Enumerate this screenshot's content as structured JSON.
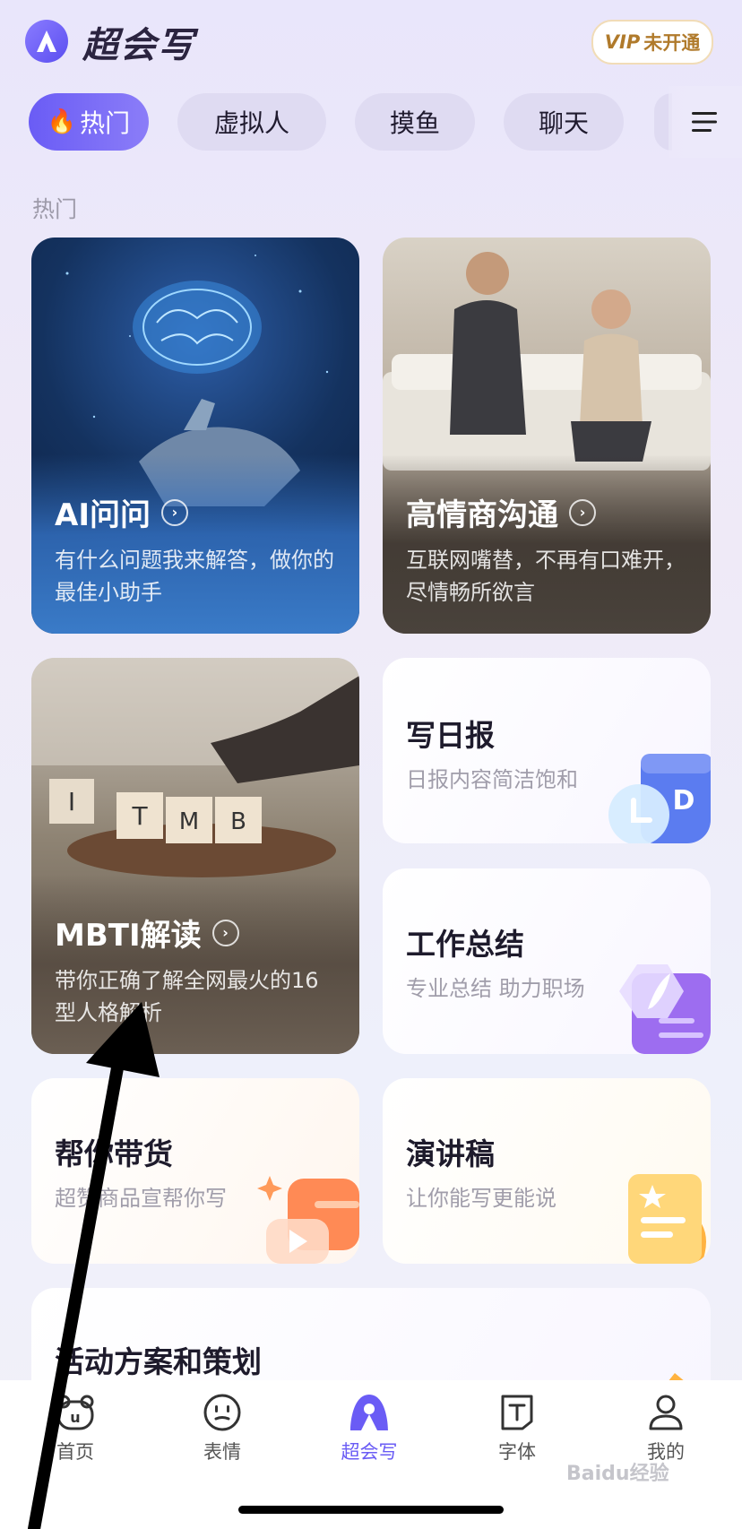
{
  "header": {
    "app_title": "超会写",
    "vip_label": "VIP",
    "vip_status": "未开通"
  },
  "tabs": [
    {
      "label": "热门",
      "icon": "fire-icon"
    },
    {
      "label": "虚拟人"
    },
    {
      "label": "摸鱼"
    },
    {
      "label": "聊天"
    }
  ],
  "section": {
    "label": "热门"
  },
  "cards": [
    {
      "title": "AI问问",
      "desc": "有什么问题我来解答，做你的最佳小助手"
    },
    {
      "title": "高情商沟通",
      "desc": "互联网嘴替，不再有口难开，尽情畅所欲言"
    },
    {
      "title": "MBTI解读",
      "desc": "带你正确了解全网最火的16型人格解析"
    },
    {
      "title": "写日报",
      "desc": "日报内容简洁饱和"
    },
    {
      "title": "工作总结",
      "desc": "专业总结 助力职场"
    },
    {
      "title": "帮你带货",
      "desc": "超赞商品宣帮你写"
    },
    {
      "title": "演讲稿",
      "desc": "让你能写更能说"
    },
    {
      "title": "活动方案和策划",
      "desc": ""
    }
  ],
  "bottom_nav": [
    {
      "label": "首页"
    },
    {
      "label": "表情"
    },
    {
      "label": "超会写"
    },
    {
      "label": "字体"
    },
    {
      "label": "我的"
    }
  ],
  "watermark": "Baidu经验",
  "colors": {
    "accent": "#6a5cf5",
    "vip": "#b07a2b"
  }
}
